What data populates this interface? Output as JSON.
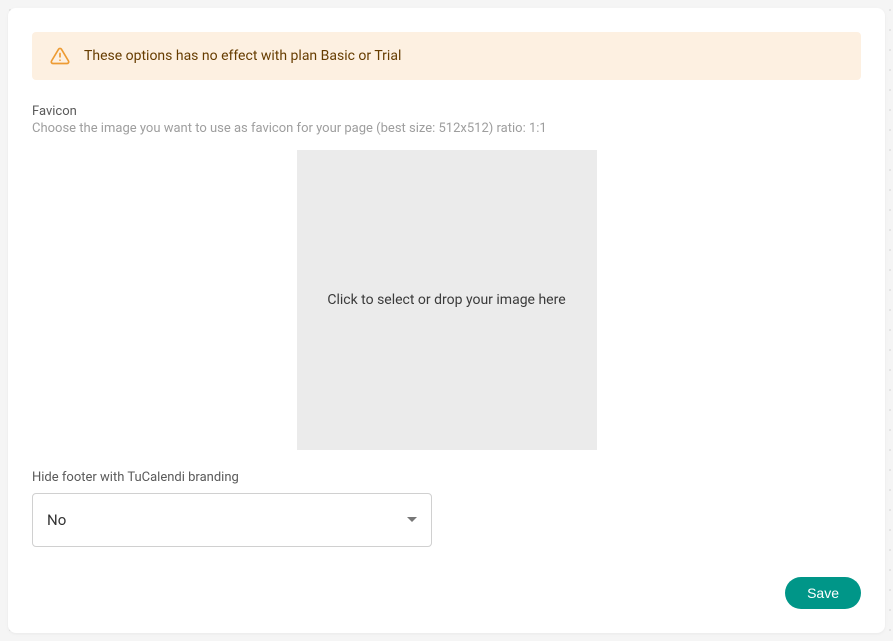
{
  "alert": {
    "message": "These options has no effect with plan Basic or Trial"
  },
  "favicon": {
    "label": "Favicon",
    "hint": "Choose the image you want to use as favicon for your page (best size: 512x512) ratio: 1:1",
    "dropzone_text": "Click to select or drop your image here"
  },
  "hideFooter": {
    "label": "Hide footer with TuCalendi branding",
    "value": "No"
  },
  "actions": {
    "save": "Save"
  }
}
